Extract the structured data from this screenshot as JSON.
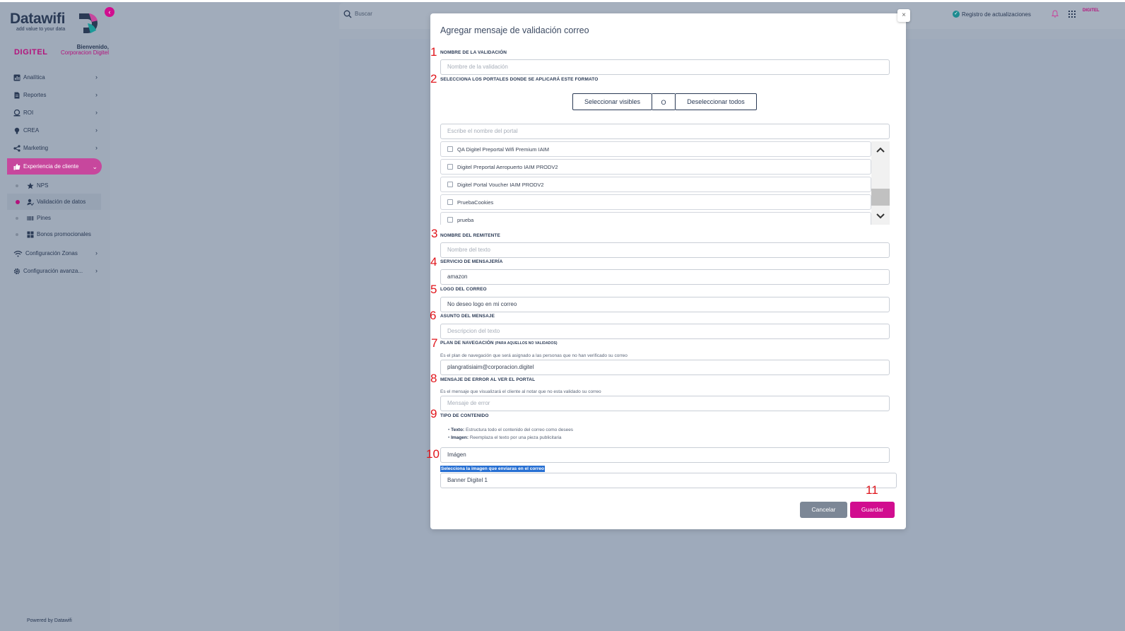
{
  "app": {
    "logo_text": "Datawifi",
    "logo_tagline": "add value to your data",
    "brand_logo": "DIGITEL",
    "welcome_title": "Bienvenido,",
    "welcome_org": "Corporacion Digitel",
    "powered_by": "Powered by Datawifi"
  },
  "sidebar": {
    "items": [
      {
        "label": "Analítica",
        "icon": "chart-icon"
      },
      {
        "label": "Reportes",
        "icon": "document-icon"
      },
      {
        "label": "ROI",
        "icon": "money-icon"
      },
      {
        "label": "CREA",
        "icon": "lightbulb-icon"
      },
      {
        "label": "Marketing",
        "icon": "share-icon"
      },
      {
        "label": "Experiencia de cliente",
        "icon": "thumbs-up-icon"
      }
    ],
    "subitems": [
      {
        "label": "NPS",
        "icon": "star-icon"
      },
      {
        "label": "Validación de datos",
        "icon": "user-check-icon"
      },
      {
        "label": "Pines",
        "icon": "barcode-icon"
      },
      {
        "label": "Bonos promocionales",
        "icon": "grid-icon"
      }
    ],
    "bottom_items": [
      {
        "label": "Configuración Zonas",
        "icon": "wifi-icon"
      },
      {
        "label": "Configuración avanza...",
        "icon": "gear-icon"
      }
    ]
  },
  "topbar": {
    "search_placeholder": "Buscar",
    "updates_label": "Registro de actualizaciones",
    "brand_small": "DIGITEL"
  },
  "modal": {
    "title": "Agregar mensaje de validación correo",
    "close_symbol": "×",
    "validation_name": {
      "label": "NOMBRE DE LA VALIDACIÓN",
      "placeholder": "Nombre de la validación"
    },
    "portals": {
      "label": "SELECCIONA LOS PORTALES DONDE SE APLICARÁ ESTE FORMATO",
      "select_visible": "Seleccionar visibles",
      "or": "O",
      "deselect_all": "Deseleccionar todos",
      "search_placeholder": "Escribe el nombre del portal",
      "list": [
        "QA Digitel Preportal Wifi Premium IAIM",
        "Digitel Preportal Aeropuerto IAIM PRODV2",
        "Digitel Portal Voucher IAIM PRODV2",
        "PruebaCookies",
        "prueba"
      ]
    },
    "sender": {
      "label": "NOMBRE DEL REMITENTE",
      "placeholder": "Nombre del texto"
    },
    "messaging": {
      "label": "SERVICIO DE MENSAJERÍA",
      "value": "amazon"
    },
    "logo": {
      "label": "LOGO DEL CORREO",
      "value": "No deseo logo en mi correo"
    },
    "subject": {
      "label": "ASUNTO DEL MENSAJE",
      "placeholder": "Descripcion del texto"
    },
    "plan": {
      "label": "PLAN DE NAVEGACIÓN",
      "label_small": "(PARA AQUELLOS NO VALIDADOS)",
      "help": "Es el plan de navegación que será asignado a las personas que no han verificado su correo",
      "value": "plangratisiaim@corporacion.digitel"
    },
    "error_msg": {
      "label": "MENSAJE DE ERROR AL VER EL PORTAL",
      "help": "Es el mensaje que visualizará el cliente al notar que no esta validado su correo",
      "placeholder": "Mensaje de error"
    },
    "content_type": {
      "label": "TIPO DE CONTENIDO",
      "bullet1_bold": "Texto:",
      "bullet1_text": "Estructura todo el contenido del correo como desees",
      "bullet2_bold": "Imagen:",
      "bullet2_text": "Reemplaza el texto por una pieza publicitaria",
      "value": "Imágen"
    },
    "image_select": {
      "label": "Selecciona la imagen que enviaras en el correo",
      "value": "Banner Digitel 1"
    },
    "cancel": "Cancelar",
    "save": "Guardar"
  },
  "annotations": [
    "1",
    "2",
    "3",
    "4",
    "5",
    "6",
    "7",
    "8",
    "9",
    "10",
    "11"
  ],
  "colors": {
    "accent": "#d10d8f",
    "annotation": "#e0151b",
    "cancel": "#7c8796"
  }
}
